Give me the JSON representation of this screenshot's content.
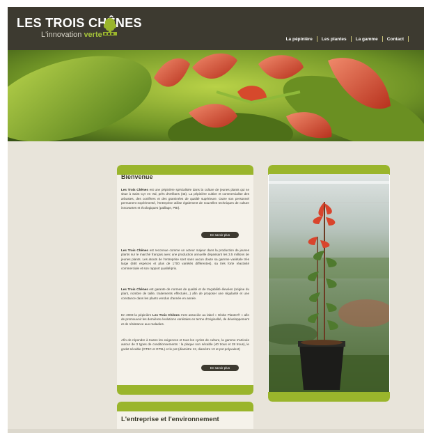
{
  "header": {
    "logo_title": "LES TROIS CHÊNES",
    "logo_tagline_prefix": "L'innovation",
    "logo_tagline_accent": "verte",
    "nav": [
      "La pépinière",
      "Les plantes",
      "La gamme",
      "Contact"
    ]
  },
  "colors": {
    "header_bg": "#3d3a30",
    "accent_green": "#9ab52c",
    "page_bg": "#e8e4da",
    "button_bg": "#3d3a30"
  },
  "welcome": {
    "title": "Bienvenue",
    "p1_brand": "Les Trois Chênes",
    "p1": " est une pépinière spécialisée dans la culture de jeunes plants qui se situe à Saint Cyr en Val, près d'Orléans (45). La pépinière cultive et commercialise des arbustes, des conifères et des graminées de qualité supérieure. Outre son personnel permanent expérimenté, l'entreprise utilise également de nouvelles techniques de culture innovantes et écologiques (paillage, PBI).",
    "btn1": "En savoir plus",
    "p2_brand": "Les Trois Chênes",
    "p2": " est reconnue comme un acteur majeur dans la production de jeunes plants sur le marché français avec une production annuelle dépassant les 3.5 millions de jeunes plants. Les atouts de l'entreprise sont sans aucun doute sa gamme variétale très large (680 espèces et plus de 1700 variétés différentes), sa très forte réactivité commerciale et son rapport qualité/prix.",
    "p3_brand": "Les Trois Chênes",
    "p3": " est garante de normes de qualité et de traçabilité élevées (origine du plant, nombre de taille, traitements effectués...) afin de proposer une régularité et une constance dans les plants vendus d'année en année.",
    "p4_start": "En 2003 la pépinière ",
    "p4_brand": "Les Trois Chênes",
    "p4": " s'est associée au label « Globe Planter® » afin de promouvoir les dernières évolutions variétales en terme d'originalité, de développement et de résistance aux maladies.",
    "p5": "Afin de répondre à toutes les exigences et tous les cycles de culture, la gamme s'articule autour de 3 types de conditionnements : la plaque non sécable (40 trous et 28 trous), le godet sécable (GT9C et GT9L) et le pot (diamètre 12, diamètre 13 et pot polyvalent)",
    "btn2": "En savoir plus"
  },
  "enterprise": {
    "title": "L'entreprise et l'environnement"
  }
}
